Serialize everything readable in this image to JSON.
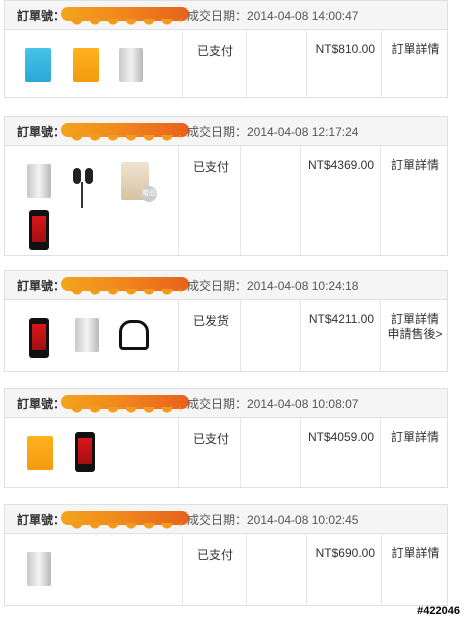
{
  "order_label": "訂單號：",
  "orders": [
    {
      "date": "成交日期：2014-04-08 14:00:47",
      "status": "已支付",
      "price": "NT$810.00",
      "detail": "訂單詳情",
      "extra": ""
    },
    {
      "date": "成交日期：2014-04-08 12:17:24",
      "status": "已支付",
      "price": "NT$4369.00",
      "detail": "訂單詳情",
      "extra": ""
    },
    {
      "date": "成交日期：2014-04-08 10:24:18",
      "status": "已发货",
      "price": "NT$4211.00",
      "detail": "訂單詳情",
      "extra": "申請售後>"
    },
    {
      "date": "成交日期：2014-04-08 10:08:07",
      "status": "已支付",
      "price": "NT$4059.00",
      "detail": "訂單詳情",
      "extra": ""
    },
    {
      "date": "成交日期：2014-04-08 10:02:45",
      "status": "已支付",
      "price": "NT$690.00",
      "detail": "訂單詳情",
      "extra": ""
    }
  ],
  "product_icons": [
    "blue-power-bank",
    "orange-power-bank",
    "silver-power-bank",
    "red-phone",
    "black-earphones",
    "gift-box",
    "otg-cable"
  ],
  "badge_text": "贈品",
  "watermark": "#422046"
}
